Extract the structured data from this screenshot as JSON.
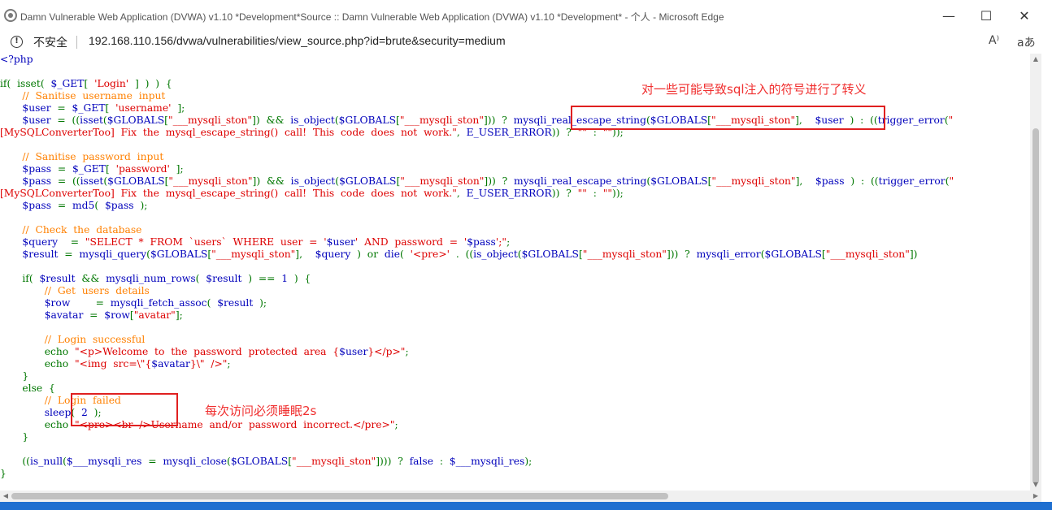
{
  "window": {
    "title": "Damn Vulnerable Web Application (DVWA) v1.10 *Development*Source :: Damn Vulnerable Web Application (DVWA) v1.10 *Development* - 个人 - Microsoft Edge",
    "minimize_glyph": "—",
    "maximize_glyph": "☐",
    "close_glyph": "✕"
  },
  "addressbar": {
    "security_label": "不安全",
    "url": "192.168.110.156/dvwa/vulnerabilities/view_source.php?id=brute&security=medium",
    "read_aloud_icon": "A⁾",
    "translate_icon": "aあ"
  },
  "code": {
    "lines": [
      [
        {
          "t": "<?php",
          "c": "var"
        }
      ],
      [],
      [
        {
          "t": "if(  isset(  ",
          "c": "kw"
        },
        {
          "t": "$_GET",
          "c": "var"
        },
        {
          "t": "[  ",
          "c": "kw"
        },
        {
          "t": "'Login'",
          "c": "str"
        },
        {
          "t": "  ]  )  )  {",
          "c": "kw"
        }
      ],
      [
        {
          "t": "       ",
          "c": "kw"
        },
        {
          "t": "//  Sanitise  username  input",
          "c": "cm"
        }
      ],
      [
        {
          "t": "       ",
          "c": "kw"
        },
        {
          "t": "$user",
          "c": "var"
        },
        {
          "t": "  =  ",
          "c": "kw"
        },
        {
          "t": "$_GET",
          "c": "var"
        },
        {
          "t": "[  ",
          "c": "kw"
        },
        {
          "t": "'username'",
          "c": "str"
        },
        {
          "t": "  ];",
          "c": "kw"
        }
      ],
      [
        {
          "t": "       ",
          "c": "kw"
        },
        {
          "t": "$user",
          "c": "var"
        },
        {
          "t": "  =  ((",
          "c": "kw"
        },
        {
          "t": "isset",
          "c": "var"
        },
        {
          "t": "(",
          "c": "kw"
        },
        {
          "t": "$GLOBALS",
          "c": "var"
        },
        {
          "t": "[",
          "c": "kw"
        },
        {
          "t": "\"___mysqli_ston\"",
          "c": "str"
        },
        {
          "t": "])  &&  ",
          "c": "kw"
        },
        {
          "t": "is_object",
          "c": "var"
        },
        {
          "t": "(",
          "c": "kw"
        },
        {
          "t": "$GLOBALS",
          "c": "var"
        },
        {
          "t": "[",
          "c": "kw"
        },
        {
          "t": "\"___mysqli_ston\"",
          "c": "str"
        },
        {
          "t": "]))  ?  ",
          "c": "kw"
        },
        {
          "t": "mysqli_real_escape_string",
          "c": "var"
        },
        {
          "t": "(",
          "c": "kw"
        },
        {
          "t": "$GLOBALS",
          "c": "var"
        },
        {
          "t": "[",
          "c": "kw"
        },
        {
          "t": "\"___mysqli_ston\"",
          "c": "str"
        },
        {
          "t": "],    ",
          "c": "kw"
        },
        {
          "t": "$user",
          "c": "var"
        },
        {
          "t": "  )  :  ((",
          "c": "kw"
        },
        {
          "t": "trigger_error",
          "c": "var"
        },
        {
          "t": "(",
          "c": "kw"
        },
        {
          "t": "\"",
          "c": "str"
        }
      ],
      [
        {
          "t": "[MySQLConverterToo]  Fix  the  mysql_escape_string()  call!  This  code  does  not  work.\"",
          "c": "str"
        },
        {
          "t": ",  ",
          "c": "kw"
        },
        {
          "t": "E_USER_ERROR",
          "c": "var"
        },
        {
          "t": "))  ?  ",
          "c": "kw"
        },
        {
          "t": "\"\"",
          "c": "str"
        },
        {
          "t": "  :  ",
          "c": "kw"
        },
        {
          "t": "\"\"",
          "c": "str"
        },
        {
          "t": "));",
          "c": "kw"
        }
      ],
      [],
      [
        {
          "t": "       ",
          "c": "kw"
        },
        {
          "t": "//  Sanitise  password  input",
          "c": "cm"
        }
      ],
      [
        {
          "t": "       ",
          "c": "kw"
        },
        {
          "t": "$pass",
          "c": "var"
        },
        {
          "t": "  =  ",
          "c": "kw"
        },
        {
          "t": "$_GET",
          "c": "var"
        },
        {
          "t": "[  ",
          "c": "kw"
        },
        {
          "t": "'password'",
          "c": "str"
        },
        {
          "t": "  ];",
          "c": "kw"
        }
      ],
      [
        {
          "t": "       ",
          "c": "kw"
        },
        {
          "t": "$pass",
          "c": "var"
        },
        {
          "t": "  =  ((",
          "c": "kw"
        },
        {
          "t": "isset",
          "c": "var"
        },
        {
          "t": "(",
          "c": "kw"
        },
        {
          "t": "$GLOBALS",
          "c": "var"
        },
        {
          "t": "[",
          "c": "kw"
        },
        {
          "t": "\"___mysqli_ston\"",
          "c": "str"
        },
        {
          "t": "])  &&  ",
          "c": "kw"
        },
        {
          "t": "is_object",
          "c": "var"
        },
        {
          "t": "(",
          "c": "kw"
        },
        {
          "t": "$GLOBALS",
          "c": "var"
        },
        {
          "t": "[",
          "c": "kw"
        },
        {
          "t": "\"___mysqli_ston\"",
          "c": "str"
        },
        {
          "t": "]))  ?  ",
          "c": "kw"
        },
        {
          "t": "mysqli_real_escape_string",
          "c": "var"
        },
        {
          "t": "(",
          "c": "kw"
        },
        {
          "t": "$GLOBALS",
          "c": "var"
        },
        {
          "t": "[",
          "c": "kw"
        },
        {
          "t": "\"___mysqli_ston\"",
          "c": "str"
        },
        {
          "t": "],    ",
          "c": "kw"
        },
        {
          "t": "$pass",
          "c": "var"
        },
        {
          "t": "  )  :  ((",
          "c": "kw"
        },
        {
          "t": "trigger_error",
          "c": "var"
        },
        {
          "t": "(",
          "c": "kw"
        },
        {
          "t": "\"",
          "c": "str"
        }
      ],
      [
        {
          "t": "[MySQLConverterToo]  Fix  the  mysql_escape_string()  call!  This  code  does  not  work.\"",
          "c": "str"
        },
        {
          "t": ",  ",
          "c": "kw"
        },
        {
          "t": "E_USER_ERROR",
          "c": "var"
        },
        {
          "t": "))  ?  ",
          "c": "kw"
        },
        {
          "t": "\"\"",
          "c": "str"
        },
        {
          "t": "  :  ",
          "c": "kw"
        },
        {
          "t": "\"\"",
          "c": "str"
        },
        {
          "t": "));",
          "c": "kw"
        }
      ],
      [
        {
          "t": "       ",
          "c": "kw"
        },
        {
          "t": "$pass",
          "c": "var"
        },
        {
          "t": "  =  ",
          "c": "kw"
        },
        {
          "t": "md5",
          "c": "var"
        },
        {
          "t": "(  ",
          "c": "kw"
        },
        {
          "t": "$pass",
          "c": "var"
        },
        {
          "t": "  );",
          "c": "kw"
        }
      ],
      [],
      [
        {
          "t": "       ",
          "c": "kw"
        },
        {
          "t": "//  Check  the  database",
          "c": "cm"
        }
      ],
      [
        {
          "t": "       ",
          "c": "kw"
        },
        {
          "t": "$query",
          "c": "var"
        },
        {
          "t": "    =  ",
          "c": "kw"
        },
        {
          "t": "\"SELECT  *  FROM  `users`  WHERE  user  =  '",
          "c": "str"
        },
        {
          "t": "$user",
          "c": "var"
        },
        {
          "t": "'  AND  password  =  '",
          "c": "str"
        },
        {
          "t": "$pass",
          "c": "var"
        },
        {
          "t": "';\"",
          "c": "str"
        },
        {
          "t": ";",
          "c": "kw"
        }
      ],
      [
        {
          "t": "       ",
          "c": "kw"
        },
        {
          "t": "$result",
          "c": "var"
        },
        {
          "t": "  =  ",
          "c": "kw"
        },
        {
          "t": "mysqli_query",
          "c": "var"
        },
        {
          "t": "(",
          "c": "kw"
        },
        {
          "t": "$GLOBALS",
          "c": "var"
        },
        {
          "t": "[",
          "c": "kw"
        },
        {
          "t": "\"___mysqli_ston\"",
          "c": "str"
        },
        {
          "t": "],    ",
          "c": "kw"
        },
        {
          "t": "$query",
          "c": "var"
        },
        {
          "t": "  )  or  ",
          "c": "kw"
        },
        {
          "t": "die",
          "c": "var"
        },
        {
          "t": "(  ",
          "c": "kw"
        },
        {
          "t": "'<pre>'",
          "c": "str"
        },
        {
          "t": "  .  ((",
          "c": "kw"
        },
        {
          "t": "is_object",
          "c": "var"
        },
        {
          "t": "(",
          "c": "kw"
        },
        {
          "t": "$GLOBALS",
          "c": "var"
        },
        {
          "t": "[",
          "c": "kw"
        },
        {
          "t": "\"___mysqli_ston\"",
          "c": "str"
        },
        {
          "t": "]))  ?  ",
          "c": "kw"
        },
        {
          "t": "mysqli_error",
          "c": "var"
        },
        {
          "t": "(",
          "c": "kw"
        },
        {
          "t": "$GLOBALS",
          "c": "var"
        },
        {
          "t": "[",
          "c": "kw"
        },
        {
          "t": "\"___mysqli_ston\"",
          "c": "str"
        },
        {
          "t": "])",
          "c": "kw"
        }
      ],
      [],
      [
        {
          "t": "       if(  ",
          "c": "kw"
        },
        {
          "t": "$result",
          "c": "var"
        },
        {
          "t": "  &&  ",
          "c": "kw"
        },
        {
          "t": "mysqli_num_rows",
          "c": "var"
        },
        {
          "t": "(  ",
          "c": "kw"
        },
        {
          "t": "$result",
          "c": "var"
        },
        {
          "t": "  )  ==  ",
          "c": "kw"
        },
        {
          "t": "1",
          "c": "var"
        },
        {
          "t": "  )  {",
          "c": "kw"
        }
      ],
      [
        {
          "t": "              ",
          "c": "kw"
        },
        {
          "t": "//  Get  users  details",
          "c": "cm"
        }
      ],
      [
        {
          "t": "              ",
          "c": "kw"
        },
        {
          "t": "$row",
          "c": "var"
        },
        {
          "t": "        =  ",
          "c": "kw"
        },
        {
          "t": "mysqli_fetch_assoc",
          "c": "var"
        },
        {
          "t": "(  ",
          "c": "kw"
        },
        {
          "t": "$result",
          "c": "var"
        },
        {
          "t": "  );",
          "c": "kw"
        }
      ],
      [
        {
          "t": "              ",
          "c": "kw"
        },
        {
          "t": "$avatar",
          "c": "var"
        },
        {
          "t": "  =  ",
          "c": "kw"
        },
        {
          "t": "$row",
          "c": "var"
        },
        {
          "t": "[",
          "c": "kw"
        },
        {
          "t": "\"avatar\"",
          "c": "str"
        },
        {
          "t": "];",
          "c": "kw"
        }
      ],
      [],
      [
        {
          "t": "              ",
          "c": "kw"
        },
        {
          "t": "//  Login  successful",
          "c": "cm"
        }
      ],
      [
        {
          "t": "              echo  ",
          "c": "kw"
        },
        {
          "t": "\"<p>Welcome  to  the  password  protected  area  {",
          "c": "str"
        },
        {
          "t": "$user",
          "c": "var"
        },
        {
          "t": "}</p>\"",
          "c": "str"
        },
        {
          "t": ";",
          "c": "kw"
        }
      ],
      [
        {
          "t": "              echo  ",
          "c": "kw"
        },
        {
          "t": "\"<img  src=\\\"{",
          "c": "str"
        },
        {
          "t": "$avatar",
          "c": "var"
        },
        {
          "t": "}\\\"  />\"",
          "c": "str"
        },
        {
          "t": ";",
          "c": "kw"
        }
      ],
      [
        {
          "t": "       }",
          "c": "kw"
        }
      ],
      [
        {
          "t": "       else  {",
          "c": "kw"
        }
      ],
      [
        {
          "t": "              ",
          "c": "kw"
        },
        {
          "t": "//  Login  failed",
          "c": "cm"
        }
      ],
      [
        {
          "t": "              ",
          "c": "kw"
        },
        {
          "t": "sleep",
          "c": "var"
        },
        {
          "t": "(  ",
          "c": "kw"
        },
        {
          "t": "2",
          "c": "var"
        },
        {
          "t": "  );",
          "c": "kw"
        }
      ],
      [
        {
          "t": "              echo  ",
          "c": "kw"
        },
        {
          "t": "\"<pre><br  />Username  and/or  password  incorrect.</pre>\"",
          "c": "str"
        },
        {
          "t": ";",
          "c": "kw"
        }
      ],
      [
        {
          "t": "       }",
          "c": "kw"
        }
      ],
      [],
      [
        {
          "t": "       ((",
          "c": "kw"
        },
        {
          "t": "is_null",
          "c": "var"
        },
        {
          "t": "(",
          "c": "kw"
        },
        {
          "t": "$___mysqli_res",
          "c": "var"
        },
        {
          "t": "  =  ",
          "c": "kw"
        },
        {
          "t": "mysqli_close",
          "c": "var"
        },
        {
          "t": "(",
          "c": "kw"
        },
        {
          "t": "$GLOBALS",
          "c": "var"
        },
        {
          "t": "[",
          "c": "kw"
        },
        {
          "t": "\"___mysqli_ston\"",
          "c": "str"
        },
        {
          "t": "])))  ?  ",
          "c": "kw"
        },
        {
          "t": "false",
          "c": "var"
        },
        {
          "t": "  :  ",
          "c": "kw"
        },
        {
          "t": "$___mysqli_res",
          "c": "var"
        },
        {
          "t": ");",
          "c": "kw"
        }
      ],
      [
        {
          "t": "}",
          "c": "kw"
        }
      ]
    ]
  },
  "annotations": {
    "escape_note": "对一些可能导致sql注入的符号进行了转义",
    "sleep_note": "每次访问必须睡眠2s"
  },
  "colors": {
    "annotation": "#e02020",
    "taskbar": "#1f6fd0"
  }
}
